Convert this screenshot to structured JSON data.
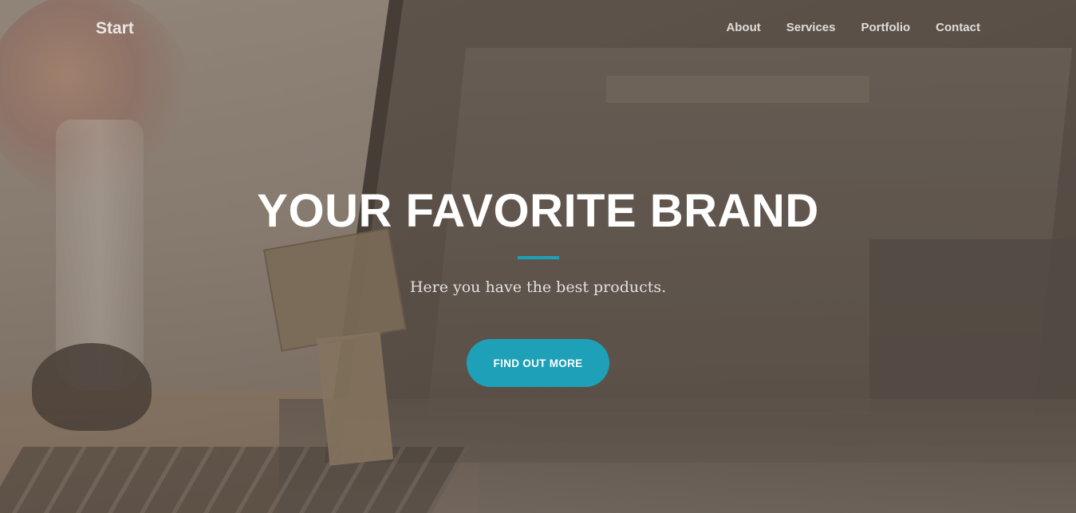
{
  "navbar": {
    "brand": "Start",
    "links": [
      {
        "label": "About"
      },
      {
        "label": "Services"
      },
      {
        "label": "Portfolio"
      },
      {
        "label": "Contact"
      }
    ]
  },
  "hero": {
    "title": "YOUR FAVORITE BRAND",
    "subtitle": "Here you have the best products.",
    "cta_label": "FIND OUT MORE"
  },
  "colors": {
    "accent": "#1ea1b8",
    "overlay": "#5c5046"
  }
}
